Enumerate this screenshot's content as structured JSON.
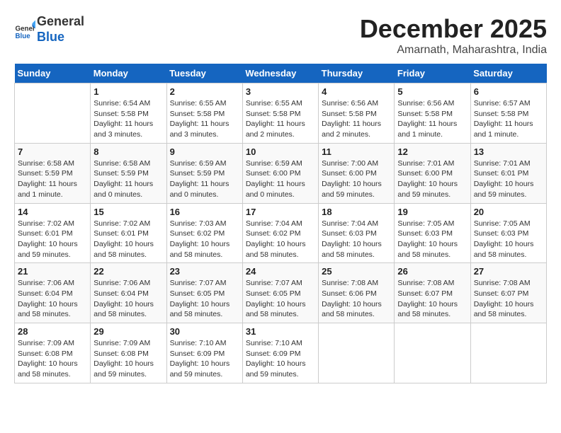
{
  "header": {
    "logo": {
      "line1": "General",
      "line2": "Blue"
    },
    "month": "December 2025",
    "location": "Amarnath, Maharashtra, India"
  },
  "days_of_week": [
    "Sunday",
    "Monday",
    "Tuesday",
    "Wednesday",
    "Thursday",
    "Friday",
    "Saturday"
  ],
  "weeks": [
    [
      {
        "day": "",
        "info": ""
      },
      {
        "day": "1",
        "info": "Sunrise: 6:54 AM\nSunset: 5:58 PM\nDaylight: 11 hours\nand 3 minutes."
      },
      {
        "day": "2",
        "info": "Sunrise: 6:55 AM\nSunset: 5:58 PM\nDaylight: 11 hours\nand 3 minutes."
      },
      {
        "day": "3",
        "info": "Sunrise: 6:55 AM\nSunset: 5:58 PM\nDaylight: 11 hours\nand 2 minutes."
      },
      {
        "day": "4",
        "info": "Sunrise: 6:56 AM\nSunset: 5:58 PM\nDaylight: 11 hours\nand 2 minutes."
      },
      {
        "day": "5",
        "info": "Sunrise: 6:56 AM\nSunset: 5:58 PM\nDaylight: 11 hours\nand 1 minute."
      },
      {
        "day": "6",
        "info": "Sunrise: 6:57 AM\nSunset: 5:58 PM\nDaylight: 11 hours\nand 1 minute."
      }
    ],
    [
      {
        "day": "7",
        "info": "Sunrise: 6:58 AM\nSunset: 5:59 PM\nDaylight: 11 hours\nand 1 minute."
      },
      {
        "day": "8",
        "info": "Sunrise: 6:58 AM\nSunset: 5:59 PM\nDaylight: 11 hours\nand 0 minutes."
      },
      {
        "day": "9",
        "info": "Sunrise: 6:59 AM\nSunset: 5:59 PM\nDaylight: 11 hours\nand 0 minutes."
      },
      {
        "day": "10",
        "info": "Sunrise: 6:59 AM\nSunset: 6:00 PM\nDaylight: 11 hours\nand 0 minutes."
      },
      {
        "day": "11",
        "info": "Sunrise: 7:00 AM\nSunset: 6:00 PM\nDaylight: 10 hours\nand 59 minutes."
      },
      {
        "day": "12",
        "info": "Sunrise: 7:01 AM\nSunset: 6:00 PM\nDaylight: 10 hours\nand 59 minutes."
      },
      {
        "day": "13",
        "info": "Sunrise: 7:01 AM\nSunset: 6:01 PM\nDaylight: 10 hours\nand 59 minutes."
      }
    ],
    [
      {
        "day": "14",
        "info": "Sunrise: 7:02 AM\nSunset: 6:01 PM\nDaylight: 10 hours\nand 59 minutes."
      },
      {
        "day": "15",
        "info": "Sunrise: 7:02 AM\nSunset: 6:01 PM\nDaylight: 10 hours\nand 58 minutes."
      },
      {
        "day": "16",
        "info": "Sunrise: 7:03 AM\nSunset: 6:02 PM\nDaylight: 10 hours\nand 58 minutes."
      },
      {
        "day": "17",
        "info": "Sunrise: 7:04 AM\nSunset: 6:02 PM\nDaylight: 10 hours\nand 58 minutes."
      },
      {
        "day": "18",
        "info": "Sunrise: 7:04 AM\nSunset: 6:03 PM\nDaylight: 10 hours\nand 58 minutes."
      },
      {
        "day": "19",
        "info": "Sunrise: 7:05 AM\nSunset: 6:03 PM\nDaylight: 10 hours\nand 58 minutes."
      },
      {
        "day": "20",
        "info": "Sunrise: 7:05 AM\nSunset: 6:03 PM\nDaylight: 10 hours\nand 58 minutes."
      }
    ],
    [
      {
        "day": "21",
        "info": "Sunrise: 7:06 AM\nSunset: 6:04 PM\nDaylight: 10 hours\nand 58 minutes."
      },
      {
        "day": "22",
        "info": "Sunrise: 7:06 AM\nSunset: 6:04 PM\nDaylight: 10 hours\nand 58 minutes."
      },
      {
        "day": "23",
        "info": "Sunrise: 7:07 AM\nSunset: 6:05 PM\nDaylight: 10 hours\nand 58 minutes."
      },
      {
        "day": "24",
        "info": "Sunrise: 7:07 AM\nSunset: 6:05 PM\nDaylight: 10 hours\nand 58 minutes."
      },
      {
        "day": "25",
        "info": "Sunrise: 7:08 AM\nSunset: 6:06 PM\nDaylight: 10 hours\nand 58 minutes."
      },
      {
        "day": "26",
        "info": "Sunrise: 7:08 AM\nSunset: 6:07 PM\nDaylight: 10 hours\nand 58 minutes."
      },
      {
        "day": "27",
        "info": "Sunrise: 7:08 AM\nSunset: 6:07 PM\nDaylight: 10 hours\nand 58 minutes."
      }
    ],
    [
      {
        "day": "28",
        "info": "Sunrise: 7:09 AM\nSunset: 6:08 PM\nDaylight: 10 hours\nand 58 minutes."
      },
      {
        "day": "29",
        "info": "Sunrise: 7:09 AM\nSunset: 6:08 PM\nDaylight: 10 hours\nand 59 minutes."
      },
      {
        "day": "30",
        "info": "Sunrise: 7:10 AM\nSunset: 6:09 PM\nDaylight: 10 hours\nand 59 minutes."
      },
      {
        "day": "31",
        "info": "Sunrise: 7:10 AM\nSunset: 6:09 PM\nDaylight: 10 hours\nand 59 minutes."
      },
      {
        "day": "",
        "info": ""
      },
      {
        "day": "",
        "info": ""
      },
      {
        "day": "",
        "info": ""
      }
    ]
  ]
}
